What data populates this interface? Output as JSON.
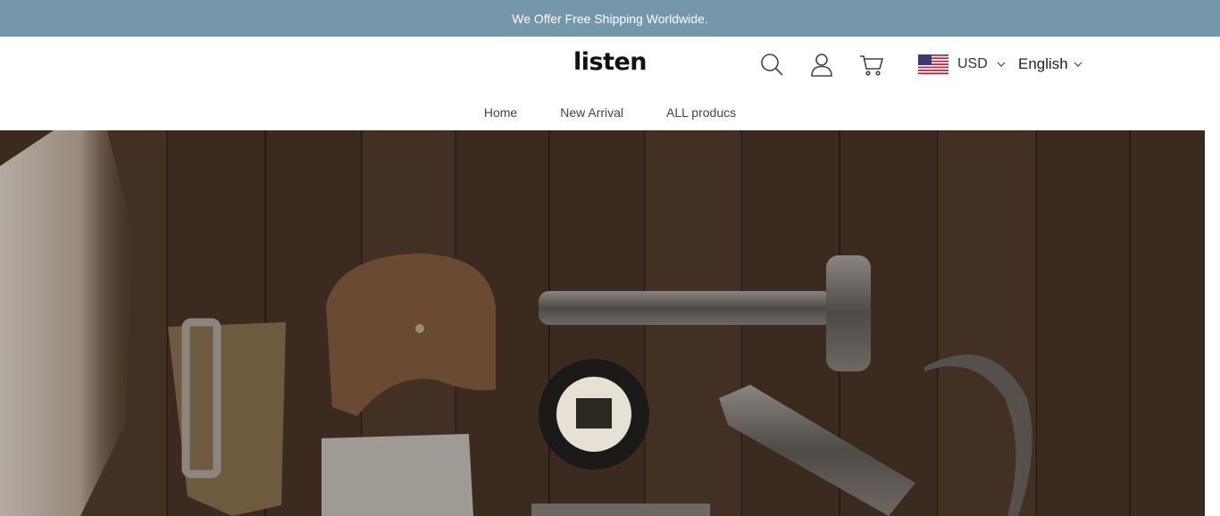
{
  "announcement": {
    "text": "We Offer Free Shipping Worldwide."
  },
  "header": {
    "logo": "listen",
    "icons": {
      "search": "search-icon",
      "account": "user-icon",
      "cart": "cart-icon"
    },
    "currency": {
      "flag": "us-flag-icon",
      "label": "USD"
    },
    "language": {
      "label": "English"
    }
  },
  "nav": {
    "items": [
      {
        "label": "Home"
      },
      {
        "label": "New Arrival"
      },
      {
        "label": "ALL producs"
      }
    ]
  },
  "hero": {
    "image": "hero-tools-on-wood-image"
  },
  "colors": {
    "announcement_bg": "#7597aa",
    "text": "#222222",
    "wood": "#3b2a1e"
  }
}
